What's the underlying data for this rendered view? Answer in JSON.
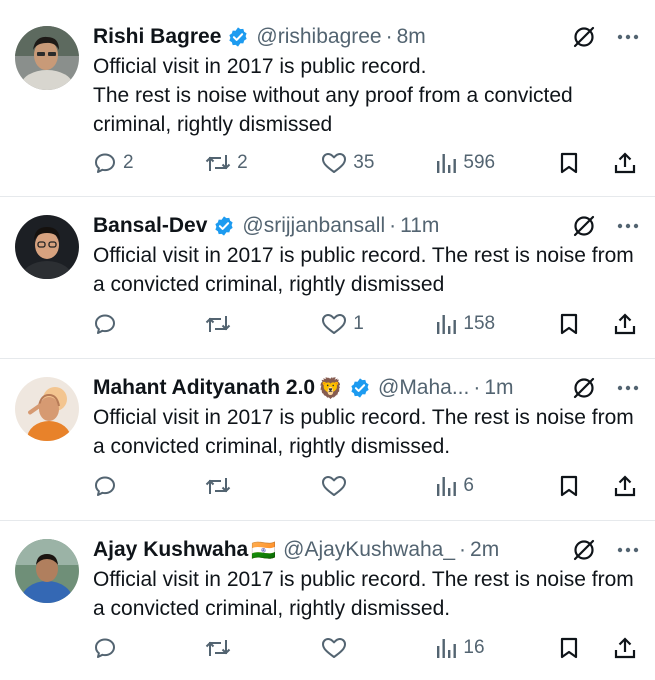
{
  "tweets": [
    {
      "name": "Rishi Bagree",
      "emoji": "",
      "verified": true,
      "handle": "@rishibagree",
      "time": "8m",
      "text": "Official visit in 2017 is public record.\nThe rest is noise without any proof from a convicted criminal, rightly dismissed",
      "replies": "2",
      "retweets": "2",
      "likes": "35",
      "views": "596"
    },
    {
      "name": "Bansal-Dev",
      "emoji": "",
      "verified": true,
      "handle": "@srijjanbansall",
      "time": "11m",
      "text": "Official visit in 2017 is public record. The rest is noise from a convicted criminal, rightly dismissed",
      "replies": "",
      "retweets": "",
      "likes": "1",
      "views": "158"
    },
    {
      "name": "Mahant Adityanath 2.0",
      "emoji": "🦁",
      "verified": true,
      "handle": "@Maha...",
      "time": "1m",
      "text": "Official visit in 2017 is public record. The rest is noise from a convicted criminal, rightly dismissed.",
      "replies": "",
      "retweets": "",
      "likes": "",
      "views": "6"
    },
    {
      "name": "Ajay Kushwaha",
      "emoji": "🇮🇳",
      "verified": false,
      "handle": "@AjayKushwaha_",
      "time": "2m",
      "text": "Official visit in 2017 is public record. The rest is noise from a convicted criminal, rightly dismissed.",
      "replies": "",
      "retweets": "",
      "likes": "",
      "views": "16"
    }
  ],
  "icons": {
    "verified": "verified-badge-icon",
    "grok": "grok-icon",
    "more": "more-icon",
    "reply": "reply-icon",
    "retweet": "retweet-icon",
    "like": "heart-icon",
    "views": "views-icon",
    "bookmark": "bookmark-icon",
    "share": "share-icon"
  },
  "colors": {
    "text": "#0f1419",
    "secondary": "#536471",
    "verified": "#1d9bf0",
    "divider": "#e6e9ec"
  }
}
